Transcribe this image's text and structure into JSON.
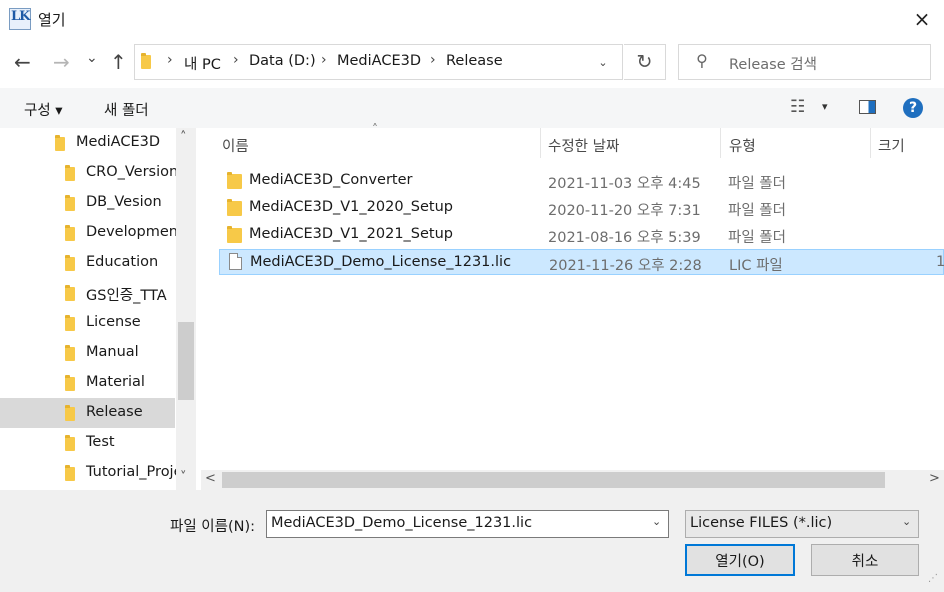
{
  "window": {
    "title": "열기",
    "close_icon": "×",
    "app_icon_text": "LK"
  },
  "nav": {
    "back_icon": "←",
    "forward_icon": "→",
    "recent_icon": "⌄",
    "up_icon": "↑",
    "breadcrumb": [
      "내 PC",
      "Data (D:)",
      "MediACE3D",
      "Release"
    ],
    "separator": "›",
    "dropdown_icon": "⌄",
    "refresh_icon": "↻",
    "search_placeholder": "Release 검색",
    "search_icon": "⚲"
  },
  "toolbar": {
    "organize_label": "구성 ▾",
    "new_folder_label": "새 폴더",
    "view_icon": "☷",
    "view_drop": "▾",
    "help_icon": "?"
  },
  "tree": {
    "items": [
      {
        "label": "MediACE3D",
        "selected": false,
        "level": 0
      },
      {
        "label": "CRO_Version",
        "selected": false,
        "level": 1
      },
      {
        "label": "DB_Vesion",
        "selected": false,
        "level": 1
      },
      {
        "label": "Development",
        "selected": false,
        "level": 1
      },
      {
        "label": "Education",
        "selected": false,
        "level": 1
      },
      {
        "label": "GS인증_TTA",
        "selected": false,
        "level": 1
      },
      {
        "label": "License",
        "selected": false,
        "level": 1
      },
      {
        "label": "Manual",
        "selected": false,
        "level": 1
      },
      {
        "label": "Material",
        "selected": false,
        "level": 1
      },
      {
        "label": "Release",
        "selected": true,
        "level": 1
      },
      {
        "label": "Test",
        "selected": false,
        "level": 1
      },
      {
        "label": "Tutorial_Proje",
        "selected": false,
        "level": 1
      }
    ],
    "scroll_up": "˄",
    "scroll_down": "˅"
  },
  "columns": {
    "name": "이름",
    "date": "수정한 날짜",
    "type": "유형",
    "size": "크기",
    "sort_icon": "˄"
  },
  "files": [
    {
      "name": "MediACE3D_Converter",
      "date": "2021-11-03 오후 4:45",
      "type": "파일 폴더",
      "size": "",
      "kind": "folder"
    },
    {
      "name": "MediACE3D_V1_2020_Setup",
      "date": "2020-11-20 오후 7:31",
      "type": "파일 폴더",
      "size": "",
      "kind": "folder"
    },
    {
      "name": "MediACE3D_V1_2021_Setup",
      "date": "2021-08-16 오후 5:39",
      "type": "파일 폴더",
      "size": "",
      "kind": "folder"
    },
    {
      "name": "MediACE3D_Demo_License_1231.lic",
      "date": "2021-11-26 오후 2:28",
      "type": "LIC 파일",
      "size": "1",
      "kind": "file",
      "selected": true
    }
  ],
  "hscroll": {
    "left": "<",
    "right": ">"
  },
  "bottom": {
    "filename_label": "파일 이름(N):",
    "filename_value": "MediACE3D_Demo_License_1231.lic",
    "filetype_value": "License FILES (*.lic)",
    "open_label": "열기(O)",
    "cancel_label": "취소"
  },
  "colors": {
    "accent": "#0078d7",
    "selection": "#cce8ff",
    "folder": "#f7c948"
  }
}
